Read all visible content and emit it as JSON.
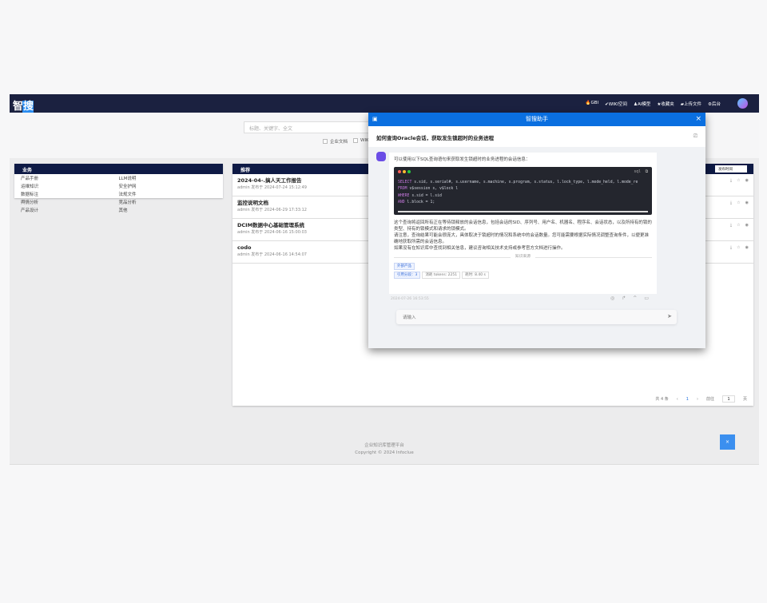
{
  "header": {
    "logo": [
      "智",
      "搜"
    ],
    "nav": [
      {
        "icon": "fire-icon",
        "label": "GBI"
      },
      {
        "icon": "check-circle-icon",
        "label": "WIKI空间"
      },
      {
        "icon": "person-icon",
        "label": "AI模型"
      },
      {
        "icon": "star-icon",
        "label": "收藏夹"
      },
      {
        "icon": "folder-icon",
        "label": "上传文件"
      },
      {
        "icon": "gear-icon",
        "label": "后台"
      }
    ]
  },
  "search": {
    "placeholder": "标题、关键字、全文",
    "filters": [
      "企业文档",
      "WIKI"
    ]
  },
  "categories": {
    "title": "业务",
    "items": [
      "产品手册",
      "LLM说明",
      "运维知识",
      "安全护网",
      "数据标注",
      "法规文件",
      "舆情分析",
      "竞品分析",
      "产品设计",
      "其他"
    ]
  },
  "recommend": {
    "title": "推荐",
    "sort": "发布时间",
    "items": [
      {
        "title": "2024-04-.搞人天工作报告",
        "meta": "admin 发布于 2024-07-24 15:12:49"
      },
      {
        "title": "监控说明文档",
        "meta": "admin 发布于 2024-06-29 17:33:12"
      },
      {
        "title": "DCIM数据中心基础管理系统",
        "meta": "admin 发布于 2024-06-16 15:00:03"
      },
      {
        "title": "codo",
        "meta": "admin 发布于 2024-06-16 14:54:07"
      }
    ],
    "pager": {
      "total": "共 4 条",
      "current": "1",
      "goto": "前往",
      "page": "1",
      "unit": "页"
    }
  },
  "footer": {
    "line1": "企业知识库管理平台",
    "line2": "Copyright © 2024 Infoclue"
  },
  "chat": {
    "title": "智搜助手",
    "question": "如何查询Oracle会话，获取发生锁超时的业务进程",
    "intro": "可以使用以下SQL查询语句来获取发生锁超时的业务进程的会话信息：",
    "code_lang": "sql",
    "code": [
      [
        "SELECT",
        " s.sid, s.serial#, s.username, s.machine, s.program, s.status, l.lock_type, l.mode_held, l.mode_re"
      ],
      [
        "FROM",
        " v$session s, v$lock l"
      ],
      [
        "WHERE",
        " s.sid = l.sid"
      ],
      [
        "AND",
        " l.block = 1;"
      ]
    ],
    "answer": [
      "这个查询将返回所有正在等待锁释放的会话信息，包括会话的SID、序列号、用户名、机器名、程序名、会话状态，以及所持有的锁的类型、持有的锁模式和请求的锁模式。",
      "请注意，查询结果可能会很庞大，具体取决于锁超时的情况和系统中的会话数量。您可能需要根据实际情况调整查询条件，以便更准确地获取所需的会话信息。",
      "如果没有在知识库中查找到相关信息，建议咨询相关技术支持或参考官方文档进行操作。"
    ],
    "source_label": "知识来源",
    "source_tag": "外部产品",
    "cite": "引用分段：3",
    "tokens": "消耗 tokens: 2251",
    "time": "耗时: 8.40 s",
    "timestamp": "2024-07-26 16:53:55",
    "input_placeholder": "请输入"
  },
  "fab": "×"
}
